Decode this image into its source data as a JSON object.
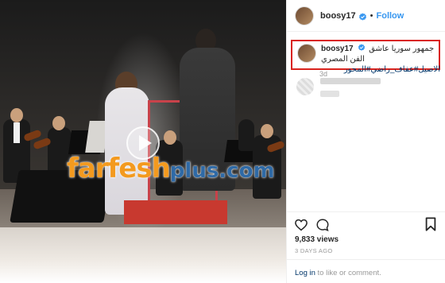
{
  "video": {
    "watermark_primary": "farfesh",
    "watermark_secondary": "plus.com",
    "play_icon": "play-icon"
  },
  "post": {
    "username": "boosy17",
    "follow_separator": "•",
    "follow_label": "Follow",
    "verified_icon": "verified-badge-icon"
  },
  "caption": {
    "username": "boosy17",
    "text": "جمهور سوريا عاشق الفن المصري",
    "tags": "الاصيل#عفاف_راضي#المحور",
    "time": "3d",
    "highlight_color": "#d9231d"
  },
  "actions": {
    "like_icon": "heart-icon",
    "comment_icon": "comment-icon",
    "save_icon": "bookmark-icon",
    "views": "9,833 views",
    "posted": "3 DAYS AGO"
  },
  "footer": {
    "login_link": "Log in",
    "login_rest": " to like or comment."
  },
  "colors": {
    "link_blue": "#3897f0",
    "watermark_orange": "#f39a1f",
    "watermark_blue": "#2f6aa6"
  }
}
